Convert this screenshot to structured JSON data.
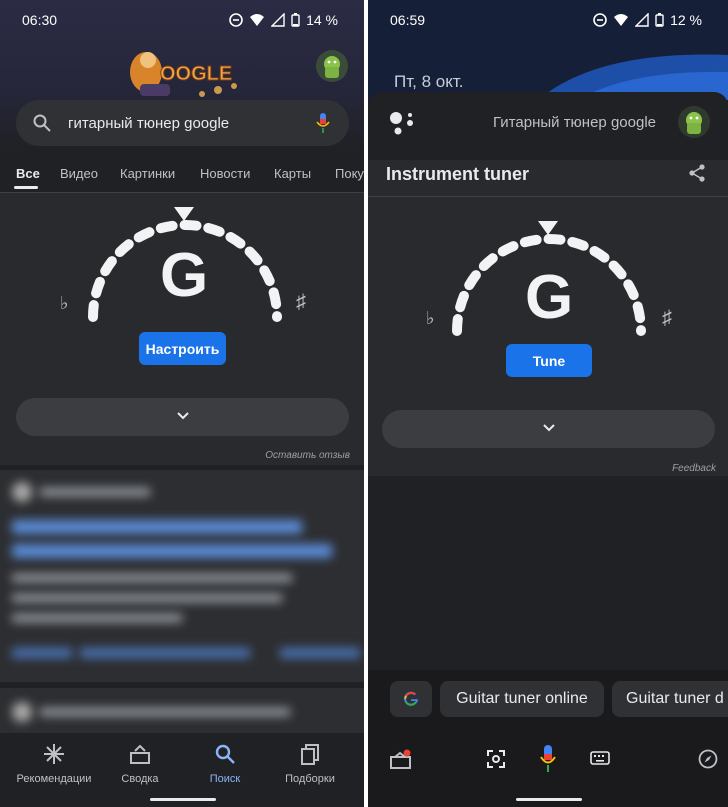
{
  "left": {
    "status": {
      "time": "06:30",
      "battery": "14 %"
    },
    "search": {
      "query": "гитарный тюнер google"
    },
    "tabs": [
      "Все",
      "Видео",
      "Картинки",
      "Новости",
      "Карты",
      "Поку"
    ],
    "tuner": {
      "note": "G",
      "flat": "♭",
      "sharp": "♯",
      "button": "Настроить"
    },
    "feedback": "Оставить отзыв",
    "bottom_nav": [
      "Рекомендации",
      "Сводка",
      "Поиск",
      "Подборки"
    ]
  },
  "right": {
    "status": {
      "time": "06:59",
      "battery": "12 %"
    },
    "date": "Пт, 8 окт.",
    "assistant_query": "Гитарный тюнер google",
    "card_title": "Instrument tuner",
    "tuner": {
      "note": "G",
      "flat": "♭",
      "sharp": "♯",
      "button": "Tune"
    },
    "feedback": "Feedback",
    "chips": [
      "Guitar tuner online",
      "Guitar tuner d"
    ]
  },
  "colors": {
    "accent": "#1a73e8",
    "active_tab": "#8ab4f8"
  }
}
